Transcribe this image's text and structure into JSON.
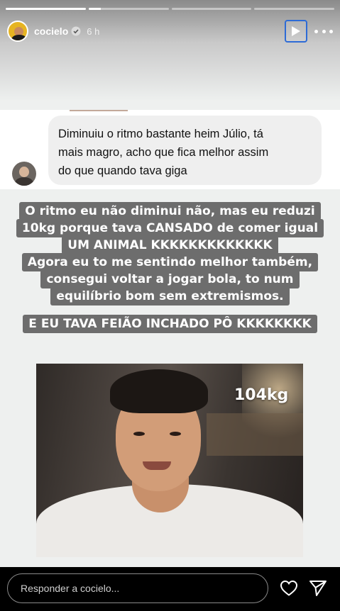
{
  "story": {
    "progress": [
      1,
      0.15,
      0,
      0
    ],
    "username": "cocielo",
    "time_ago": "6 h",
    "verified": true
  },
  "comment": {
    "text_lines": [
      "Diminuiu o ritmo bastante heim Júlio, tá",
      "mais magro, acho que fica melhor assim",
      "do que quando tava giga"
    ]
  },
  "reply": {
    "lines": [
      "O ritmo eu não diminui não, mas eu reduzi",
      "10kg porque tava CANSADO de comer igual",
      "UM ANIMAL KKKKKKKKKKKKK",
      "Agora eu to me sentindo melhor também,",
      "consegui voltar a jogar bola, to num",
      "equilíbrio bom sem extremismos."
    ],
    "shout": "E EU TAVA FEIÃO INCHADO PÔ KKKKKKKK"
  },
  "video": {
    "overlay_text": "104kg"
  },
  "footer": {
    "reply_placeholder": "Responder a cocielo..."
  },
  "icons": {
    "play": "play-icon",
    "more": "more-options-icon",
    "heart": "heart-icon",
    "send": "send-icon",
    "verified": "verified-badge-icon"
  },
  "colors": {
    "highlight_bg": "#6d6d6d",
    "focus_ring": "#2d6bd6",
    "verified_blue": "#3897f0"
  }
}
